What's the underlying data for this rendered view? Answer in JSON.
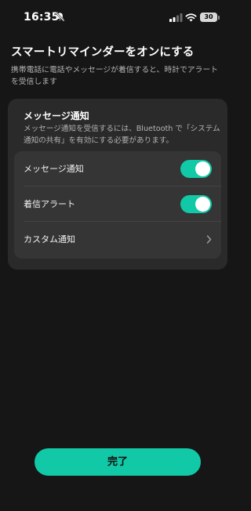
{
  "status_bar": {
    "time": "16:35",
    "battery": "30",
    "icons": [
      "bell-off-icon",
      "cellular-signal-icon",
      "wifi-icon",
      "battery-icon"
    ]
  },
  "header": {
    "title": "スマートリマインダーをオンにする",
    "subtitle": "携帯電話に電話やメッセージが着信すると、時計でアラートを受信します"
  },
  "card": {
    "title": "メッセージ通知",
    "description": "メッセージ通知を受信するには、Bluetooth で「システム通知の共有」を有効にする必要があります。",
    "rows": [
      {
        "label": "メッセージ通知",
        "control": "toggle",
        "on": true
      },
      {
        "label": "着信アラート",
        "control": "toggle",
        "on": true
      },
      {
        "label": "カスタム通知",
        "control": "chevron-right-icon"
      }
    ]
  },
  "done_button": {
    "label": "完了"
  },
  "colors": {
    "background": "#161616",
    "card": "#2a2a2a",
    "list": "#353535",
    "accent": "#11c9a6",
    "secondary_text": "#b3b3b3"
  }
}
